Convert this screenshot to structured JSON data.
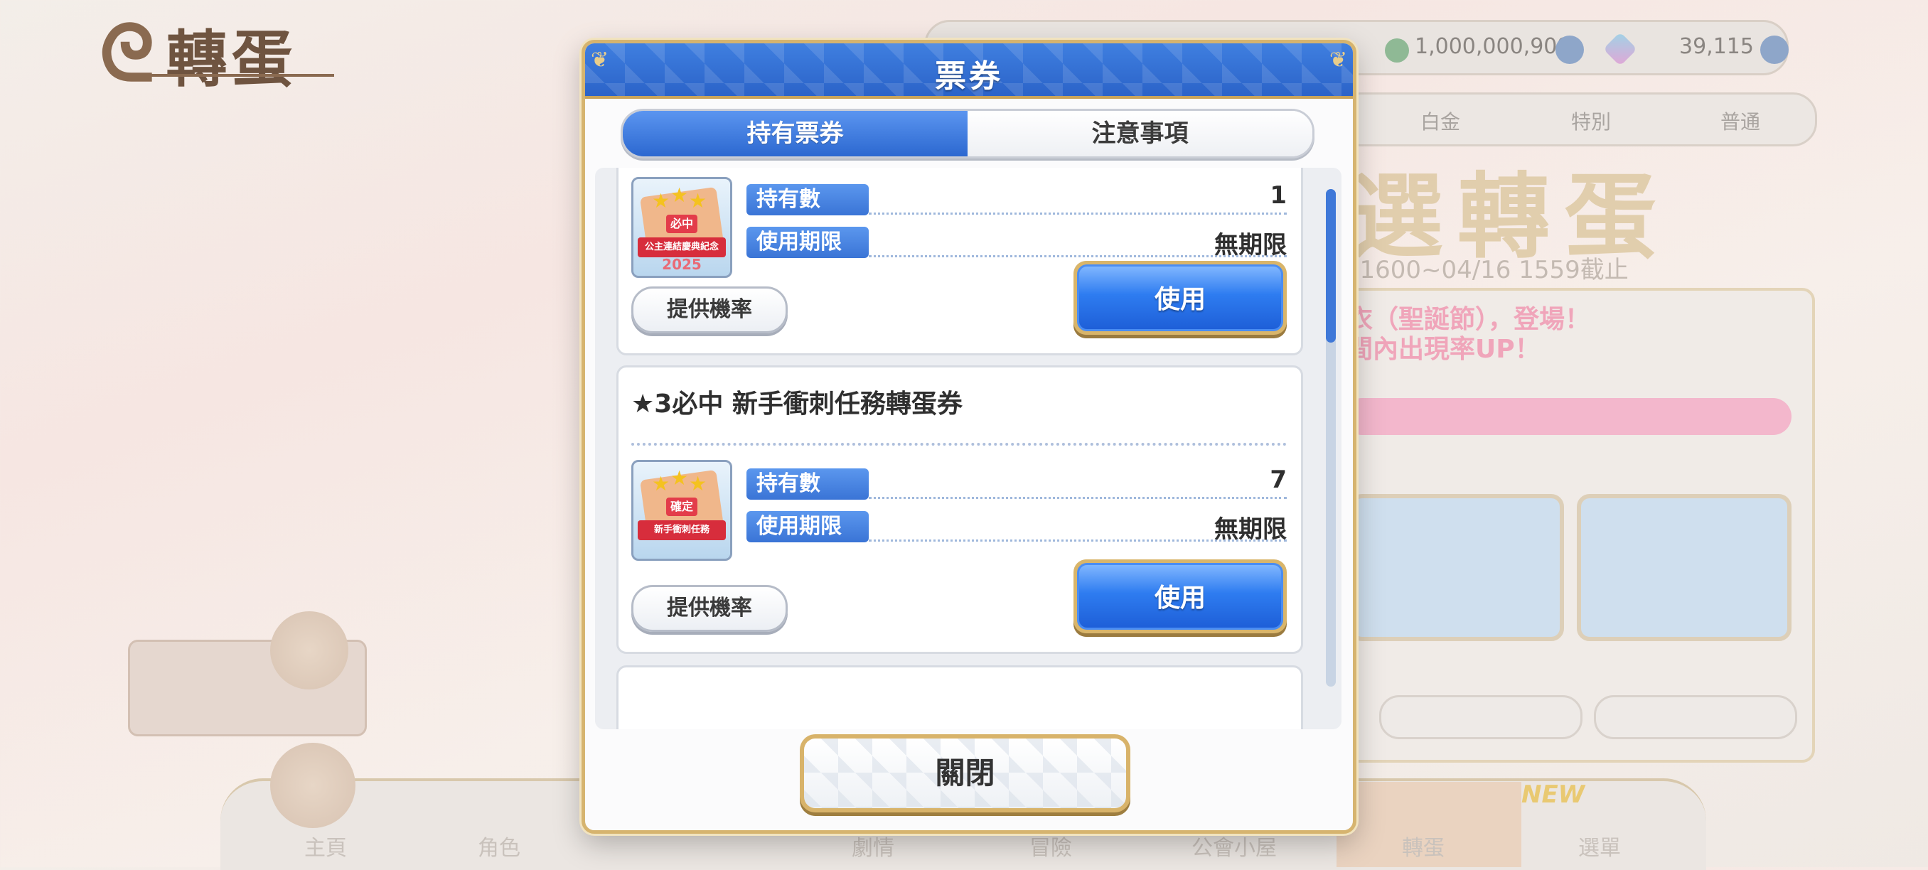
{
  "background": {
    "title": "轉蛋",
    "currencies": [
      {
        "icon": "coin-icon",
        "value": "1,000,000,909"
      },
      {
        "icon": "jewel-icon",
        "value": "39,115"
      }
    ],
    "tabs": [
      "白金",
      "特別",
      "普通"
    ],
    "banner_title": "選轉蛋",
    "nav_items": [
      "主頁",
      "角色",
      "冒險",
      "劇情",
      "冒險",
      "公會小屋",
      "轉蛋",
      "選單"
    ],
    "new_badge": "NEW"
  },
  "modal": {
    "title": "票券",
    "tabs": {
      "held": "持有票券",
      "notes": "注意事項"
    },
    "tickets": [
      {
        "name": "",
        "icon": "ticket-icon",
        "icon_mark": "必中",
        "icon_ribbon": "公主連結慶典紀念",
        "icon_year": "2025",
        "count_label": "持有數",
        "count": "1",
        "expiry_label": "使用期限",
        "expiry": "無期限",
        "odds_button": "提供機率",
        "use_button": "使用"
      },
      {
        "name": "★3必中 新手衝刺任務轉蛋券",
        "icon": "ticket-icon",
        "icon_mark": "確定",
        "icon_ribbon": "新手衝刺任務",
        "icon_year": "",
        "count_label": "持有數",
        "count": "7",
        "expiry_label": "使用期限",
        "expiry": "無期限",
        "odds_button": "提供機率",
        "use_button": "使用"
      }
    ],
    "close_button": "關閉"
  }
}
